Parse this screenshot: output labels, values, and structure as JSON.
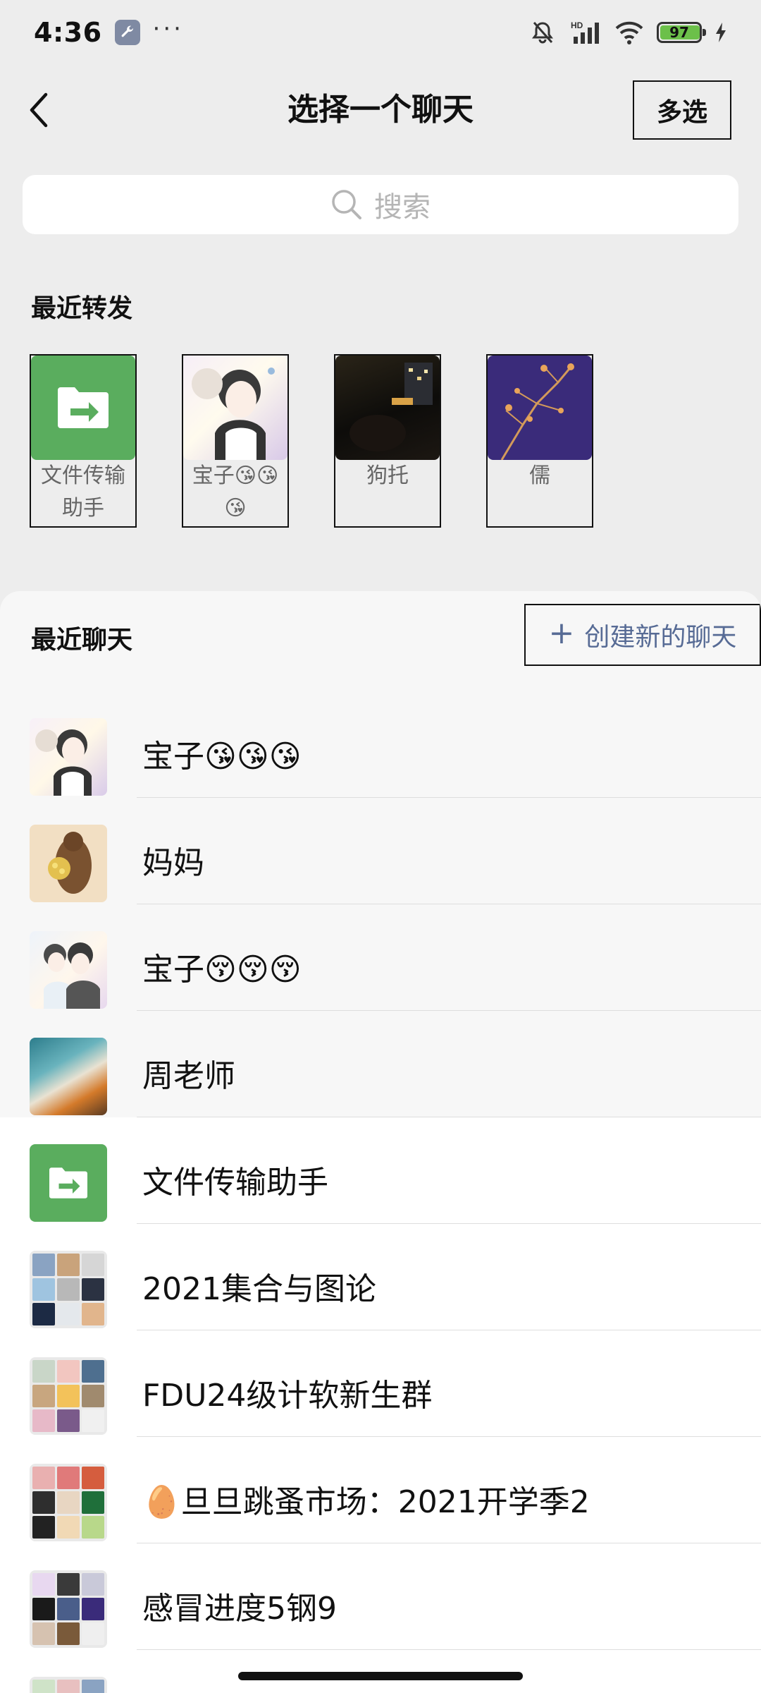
{
  "status_bar": {
    "time": "4:36",
    "dots": "···",
    "battery": "97",
    "network": "HD"
  },
  "header": {
    "title": "选择一个聊天",
    "multi_select": "多选"
  },
  "search": {
    "placeholder": "搜索"
  },
  "recent_forwards": {
    "label": "最近转发",
    "items": [
      {
        "name": "文件传输助手"
      },
      {
        "name": "宝子😘😘😘"
      },
      {
        "name": "狗托"
      },
      {
        "name": "儒"
      }
    ]
  },
  "recent_chats": {
    "label": "最近聊天",
    "create_label": "创建新的聊天",
    "items": [
      {
        "name": "宝子😘😘😘"
      },
      {
        "name": "妈妈"
      },
      {
        "name": "宝子😚😚😚"
      },
      {
        "name": "周老师"
      },
      {
        "name": "文件传输助手"
      },
      {
        "name": "2021集合与图论"
      },
      {
        "name": "FDU24级计软新生群"
      },
      {
        "name": "🥚旦旦跳蚤市场：2021开学季2"
      },
      {
        "name": "感冒进度5钢9"
      }
    ]
  },
  "colors": {
    "accent_link": "#576b95",
    "file_green": "#5aad5e",
    "background": "#ededed",
    "battery_green": "#6cc04a"
  }
}
